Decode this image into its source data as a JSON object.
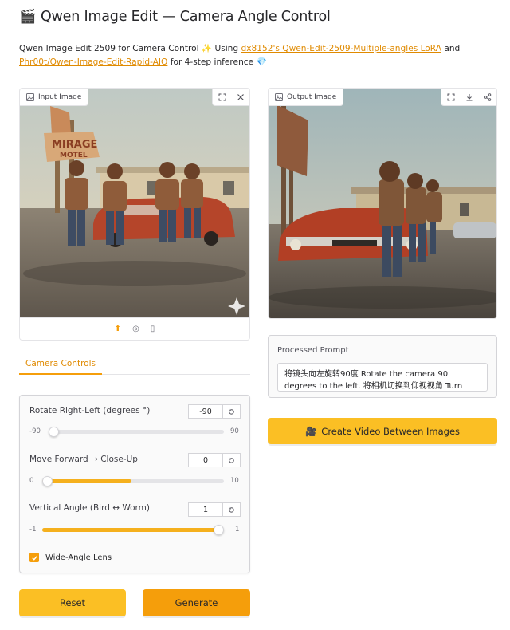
{
  "header": {
    "title": "Qwen Image Edit — Camera Angle Control",
    "title_icon": "clapper-board-icon"
  },
  "description": {
    "prefix": "Qwen Image Edit 2509 for Camera Control ✨ Using ",
    "link1": "dx8152's Qwen-Edit-2509-Multiple-angles LoRA",
    "and": " and ",
    "link2": "Phr00t/Qwen-Image-Edit-Rapid-AIO",
    "suffix": " for 4-step inference 💎"
  },
  "input_panel": {
    "label": "Input Image"
  },
  "output_panel": {
    "label": "Output Image"
  },
  "tabs": {
    "active": "Camera Controls"
  },
  "controls": {
    "rotate": {
      "label": "Rotate Right-Left (degrees °)",
      "value": "-90",
      "min": "-90",
      "max": "90",
      "fraction": 0.0
    },
    "forward": {
      "label": "Move Forward → Close-Up",
      "value": "0",
      "min": "0",
      "max": "10",
      "fraction": 0.0
    },
    "vertical": {
      "label": "Vertical Angle (Bird ↔ Worm)",
      "value": "1",
      "min": "-1",
      "max": "1",
      "fraction": 1.0
    },
    "wide_angle": {
      "label": "Wide-Angle Lens",
      "checked": true
    }
  },
  "buttons": {
    "reset": "Reset",
    "generate": "Generate",
    "video": "Create Video Between Images"
  },
  "prompt": {
    "label": "Processed Prompt",
    "text": "将镜头向左旋转90度 Rotate the camera 90 degrees to the left. 将相机切换到仰视视角 Turn"
  },
  "colors": {
    "accent": "#f59e0b",
    "accent_light": "#fbbf24",
    "link": "#e08a00"
  }
}
